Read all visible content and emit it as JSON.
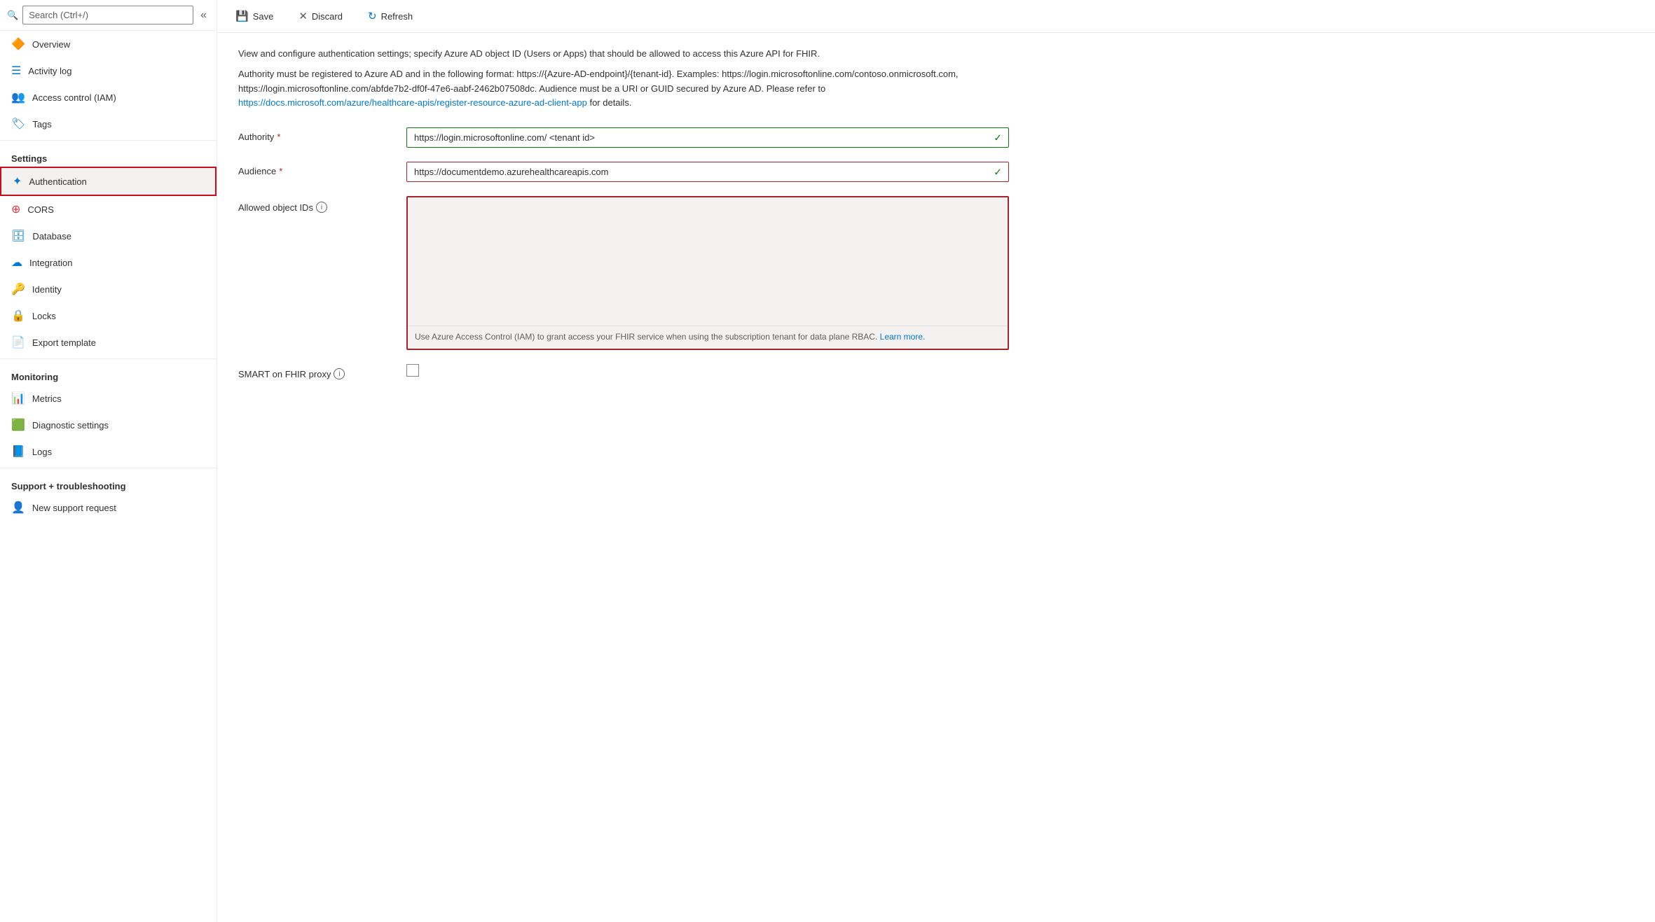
{
  "sidebar": {
    "search_placeholder": "Search (Ctrl+/)",
    "collapse_icon": "«",
    "nav_items_top": [
      {
        "id": "overview",
        "label": "Overview",
        "icon": "🔶"
      },
      {
        "id": "activity-log",
        "label": "Activity log",
        "icon": "📋"
      },
      {
        "id": "access-control",
        "label": "Access control (IAM)",
        "icon": "👥"
      },
      {
        "id": "tags",
        "label": "Tags",
        "icon": "🏷"
      }
    ],
    "section_settings": "Settings",
    "nav_items_settings": [
      {
        "id": "authentication",
        "label": "Authentication",
        "icon": "✦",
        "active": true
      },
      {
        "id": "cors",
        "label": "CORS",
        "icon": "⊕"
      },
      {
        "id": "database",
        "label": "Database",
        "icon": "🗄"
      },
      {
        "id": "integration",
        "label": "Integration",
        "icon": "☁"
      },
      {
        "id": "identity",
        "label": "Identity",
        "icon": "🔑"
      },
      {
        "id": "locks",
        "label": "Locks",
        "icon": "🔒"
      },
      {
        "id": "export-template",
        "label": "Export template",
        "icon": "📄"
      }
    ],
    "section_monitoring": "Monitoring",
    "nav_items_monitoring": [
      {
        "id": "metrics",
        "label": "Metrics",
        "icon": "📊"
      },
      {
        "id": "diagnostic",
        "label": "Diagnostic settings",
        "icon": "🟩"
      },
      {
        "id": "logs",
        "label": "Logs",
        "icon": "📘"
      }
    ],
    "section_support": "Support + troubleshooting",
    "nav_items_support": [
      {
        "id": "new-support",
        "label": "New support request",
        "icon": "👤"
      }
    ]
  },
  "toolbar": {
    "save_label": "Save",
    "discard_label": "Discard",
    "refresh_label": "Refresh"
  },
  "main": {
    "description1": "View and configure authentication settings; specify Azure AD object ID (Users or Apps) that should be allowed to access this Azure API for FHIR.",
    "description2": "Authority must be registered to Azure AD and in the following format: https://{Azure-AD-endpoint}/{tenant-id}. Examples: https://login.microsoftonline.com/contoso.onmicrosoft.com, https://login.microsoftonline.com/abfde7b2-df0f-47e6-aabf-2462b07508dc. Audience must be a URI or GUID secured by Azure AD. Please refer to",
    "description_link_text": "https://docs.microsoft.com/azure/healthcare-apis/register-resource-azure-ad-client-app",
    "description_link_url": "https://docs.microsoft.com/azure/healthcare-apis/register-resource-azure-ad-client-app",
    "description3": "for details.",
    "authority_label": "Authority",
    "authority_required": "*",
    "authority_value": "https://login.microsoftonline.com/ <tenant id>",
    "audience_label": "Audience",
    "audience_required": "*",
    "audience_value": "https://documentdemo.azurehealthcareapis.com",
    "allowed_object_ids_label": "Allowed object IDs",
    "allowed_object_ids_textarea_value": "",
    "allowed_object_ids_hint": "Use Azure Access Control (IAM) to grant access your FHIR service when using the subscription tenant for data plane RBAC.",
    "allowed_object_ids_link_text": "Learn more.",
    "smart_label": "SMART on FHIR proxy"
  }
}
